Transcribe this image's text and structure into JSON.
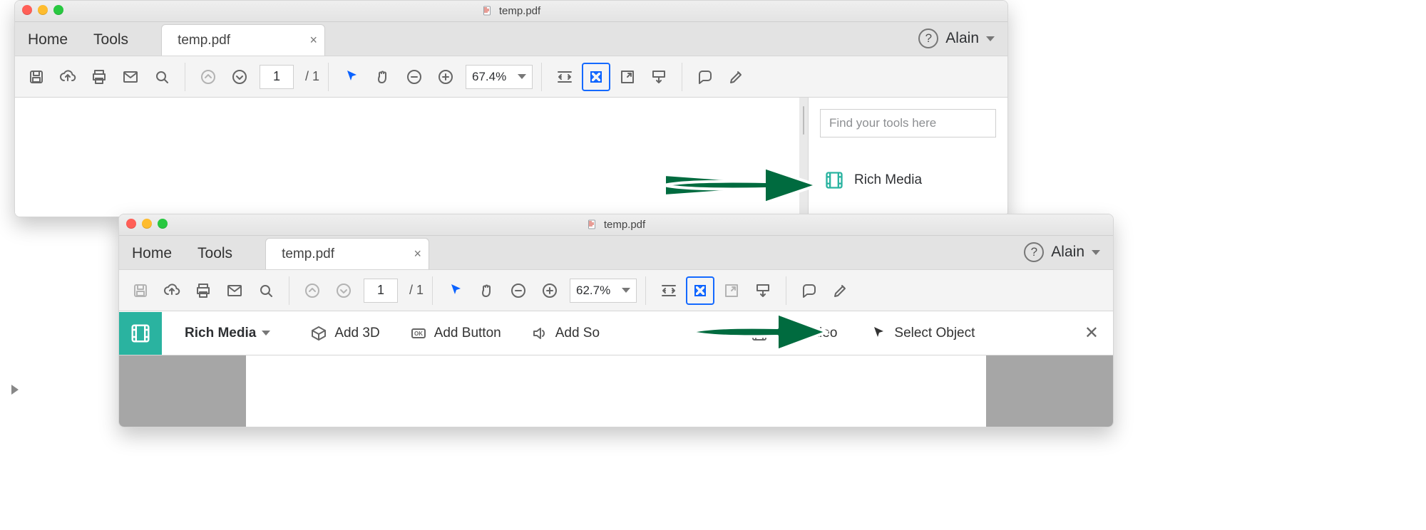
{
  "window1": {
    "title": "temp.pdf",
    "nav": {
      "home": "Home",
      "tools": "Tools"
    },
    "tab": {
      "label": "temp.pdf",
      "close": "×"
    },
    "user": "Alain",
    "toolbar": {
      "page_current": "1",
      "page_of": "/  1",
      "zoom": "67.4%"
    },
    "right": {
      "search_placeholder": "Find your tools here",
      "rich_media": "Rich Media"
    }
  },
  "window2": {
    "title": "temp.pdf",
    "nav": {
      "home": "Home",
      "tools": "Tools"
    },
    "tab": {
      "label": "temp.pdf",
      "close": "×"
    },
    "user": "Alain",
    "toolbar": {
      "page_current": "1",
      "page_of": "/  1",
      "zoom": "62.7%"
    },
    "rm": {
      "title": "Rich Media",
      "add_3d": "Add 3D",
      "add_button": "Add Button",
      "add_so": "Add So",
      "add_video": "Add Video",
      "select_object": "Select Object",
      "close": "✕"
    }
  }
}
